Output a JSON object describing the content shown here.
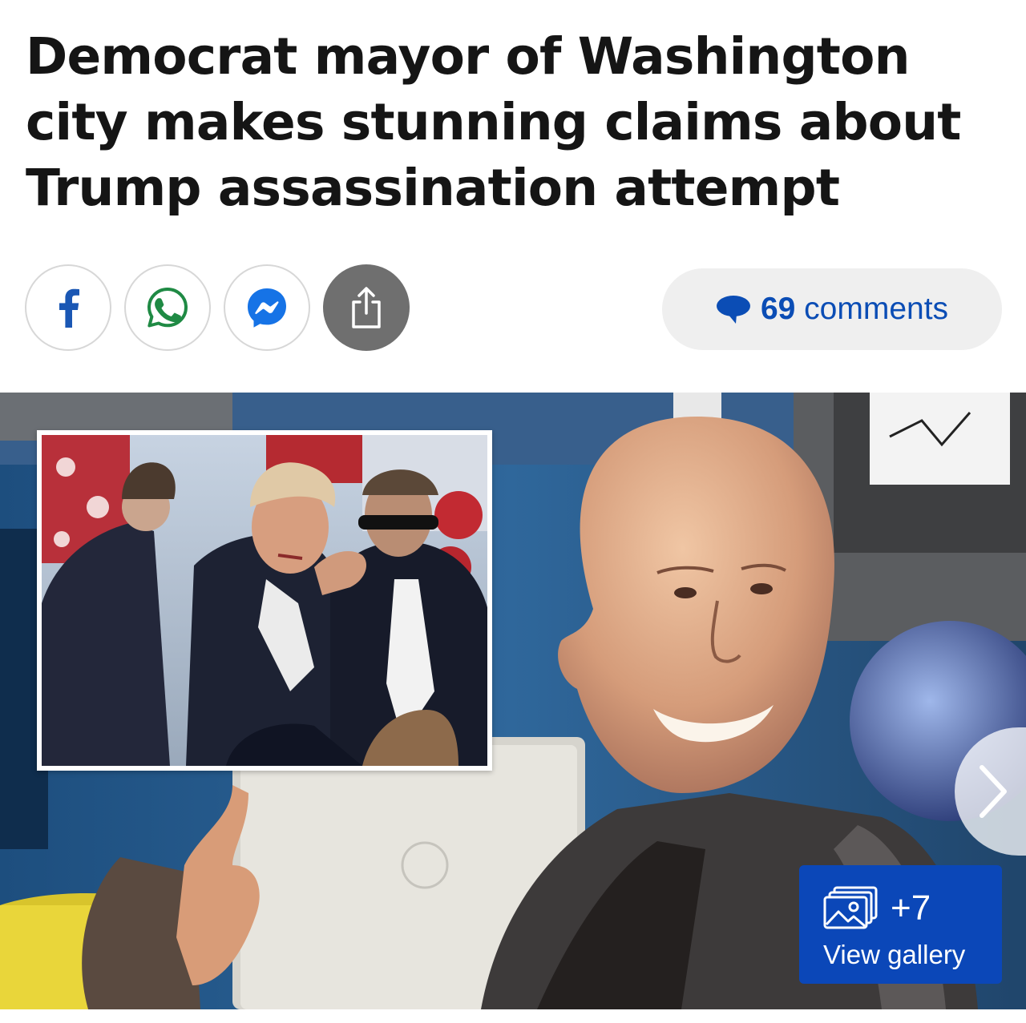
{
  "article": {
    "headline": "Democrat mayor of Washington city makes stunning claims about Trump assassination attempt"
  },
  "share": {
    "facebook_icon": "facebook-icon",
    "whatsapp_icon": "whatsapp-icon",
    "messenger_icon": "messenger-icon",
    "share_icon": "share-icon"
  },
  "comments": {
    "count": "69",
    "label": "comments",
    "icon": "speech-bubble-icon"
  },
  "gallery": {
    "count": "+7",
    "label": "View gallery",
    "icon": "image-stack-icon"
  },
  "carousel": {
    "next_icon": "chevron-right-icon"
  },
  "colors": {
    "accent_blue": "#0b47b8",
    "comments_text": "#0b4db5",
    "facebook": "#1a57b4",
    "whatsapp": "#1f8a44",
    "messenger": "#1673e6",
    "headline": "#151515"
  }
}
